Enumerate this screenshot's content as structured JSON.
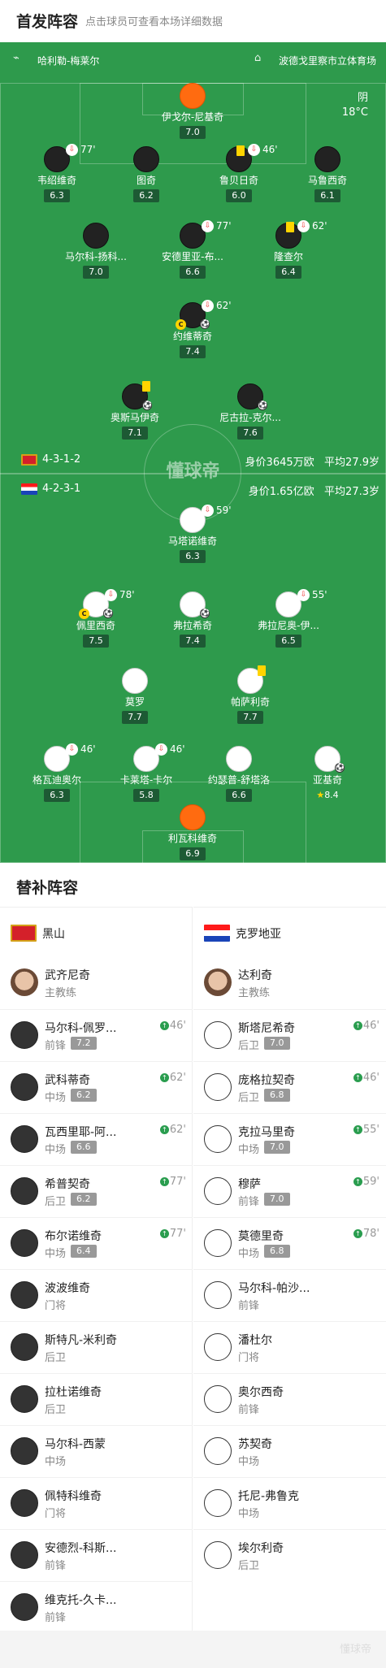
{
  "header": {
    "title": "首发阵容",
    "hint": "点击球员可查看本场详细数据"
  },
  "pitch": {
    "referee": "哈利勒-梅莱尔",
    "stadium": "波德戈里察市立体育场",
    "weather": "阴",
    "temperature": "18°C",
    "watermark": "懂球帝",
    "home": {
      "formation": "4-3-1-2",
      "value": "身价3645万欧",
      "age": "平均27.9岁"
    },
    "away": {
      "formation": "4-2-3-1",
      "value": "身价1.65亿欧",
      "age": "平均27.3岁"
    },
    "home_players": [
      {
        "name": "伊戈尔-尼基奇",
        "rating": "7.0"
      },
      {
        "name": "韦绍维奇",
        "rating": "6.3",
        "sub": "77'"
      },
      {
        "name": "图奇",
        "rating": "6.2"
      },
      {
        "name": "鲁贝日奇",
        "rating": "6.0",
        "sub": "46'"
      },
      {
        "name": "马鲁西奇",
        "rating": "6.1"
      },
      {
        "name": "马尔科-扬科...",
        "rating": "7.0"
      },
      {
        "name": "安德里亚-布...",
        "rating": "6.6",
        "sub": "77'"
      },
      {
        "name": "隆查尔",
        "rating": "6.4",
        "sub": "62'"
      },
      {
        "name": "约维蒂奇",
        "rating": "7.4",
        "sub": "62'"
      },
      {
        "name": "奥斯马伊奇",
        "rating": "7.1"
      },
      {
        "name": "尼古拉-克尔...",
        "rating": "7.6"
      }
    ],
    "away_players": [
      {
        "name": "马塔诺维奇",
        "rating": "6.3",
        "sub": "59'"
      },
      {
        "name": "佩里西奇",
        "rating": "7.5",
        "sub": "78'"
      },
      {
        "name": "弗拉希奇",
        "rating": "7.4"
      },
      {
        "name": "弗拉尼奥-伊...",
        "rating": "6.5",
        "sub": "55'"
      },
      {
        "name": "莫罗",
        "rating": "7.7"
      },
      {
        "name": "帕萨利奇",
        "rating": "7.7"
      },
      {
        "name": "格瓦迪奥尔",
        "rating": "6.3",
        "sub": "46'"
      },
      {
        "name": "卡莱塔-卡尔",
        "rating": "5.8",
        "sub": "46'"
      },
      {
        "name": "约瑟普-舒塔洛",
        "rating": "6.6"
      },
      {
        "name": "亚基奇",
        "rating": "8.4"
      },
      {
        "name": "利瓦科维奇",
        "rating": "6.9"
      }
    ]
  },
  "subs": {
    "title": "替补阵容",
    "home": {
      "team": "黑山",
      "coach": {
        "name": "武齐尼奇",
        "role": "主教练"
      },
      "players": [
        {
          "name": "马尔科-佩罗...",
          "pos": "前锋",
          "rating": "7.2",
          "min": "46'"
        },
        {
          "name": "武科蒂奇",
          "pos": "中场",
          "rating": "6.2",
          "min": "62'"
        },
        {
          "name": "瓦西里耶-阿...",
          "pos": "中场",
          "rating": "6.6",
          "min": "62'"
        },
        {
          "name": "希普契奇",
          "pos": "后卫",
          "rating": "6.2",
          "min": "77'"
        },
        {
          "name": "布尔诺维奇",
          "pos": "中场",
          "rating": "6.4",
          "min": "77'"
        },
        {
          "name": "波波维奇",
          "pos": "门将"
        },
        {
          "name": "斯特凡-米利奇",
          "pos": "后卫"
        },
        {
          "name": "拉杜诺维奇",
          "pos": "后卫"
        },
        {
          "name": "马尔科-西蒙",
          "pos": "中场"
        },
        {
          "name": "佩特科维奇",
          "pos": "门将"
        },
        {
          "name": "安德烈-科斯...",
          "pos": "前锋"
        },
        {
          "name": "维克托-久卡...",
          "pos": "前锋"
        }
      ]
    },
    "away": {
      "team": "克罗地亚",
      "coach": {
        "name": "达利奇",
        "role": "主教练"
      },
      "players": [
        {
          "name": "斯塔尼希奇",
          "pos": "后卫",
          "rating": "7.0",
          "min": "46'"
        },
        {
          "name": "庞格拉契奇",
          "pos": "后卫",
          "rating": "6.8",
          "min": "46'"
        },
        {
          "name": "克拉马里奇",
          "pos": "中场",
          "rating": "7.0",
          "min": "55'"
        },
        {
          "name": "穆萨",
          "pos": "前锋",
          "rating": "7.0",
          "min": "59'"
        },
        {
          "name": "莫德里奇",
          "pos": "中场",
          "rating": "6.8",
          "min": "78'"
        },
        {
          "name": "马尔科-帕沙...",
          "pos": "前锋"
        },
        {
          "name": "潘杜尔",
          "pos": "门将"
        },
        {
          "name": "奥尔西奇",
          "pos": "前锋"
        },
        {
          "name": "苏契奇",
          "pos": "中场"
        },
        {
          "name": "托尼-弗鲁克",
          "pos": "中场"
        },
        {
          "name": "埃尔利奇",
          "pos": "后卫"
        }
      ]
    }
  },
  "footer": {
    "watermark": "懂球帝"
  },
  "colors": {
    "pitch": "#2e9a4c",
    "keeper": "#ff6b10",
    "home_kit": "#222222",
    "away_kit": "#ffffff",
    "rating_bg": "#1d5a34",
    "sub_up": "#2a9d4f",
    "yellow": "#ffd400"
  }
}
